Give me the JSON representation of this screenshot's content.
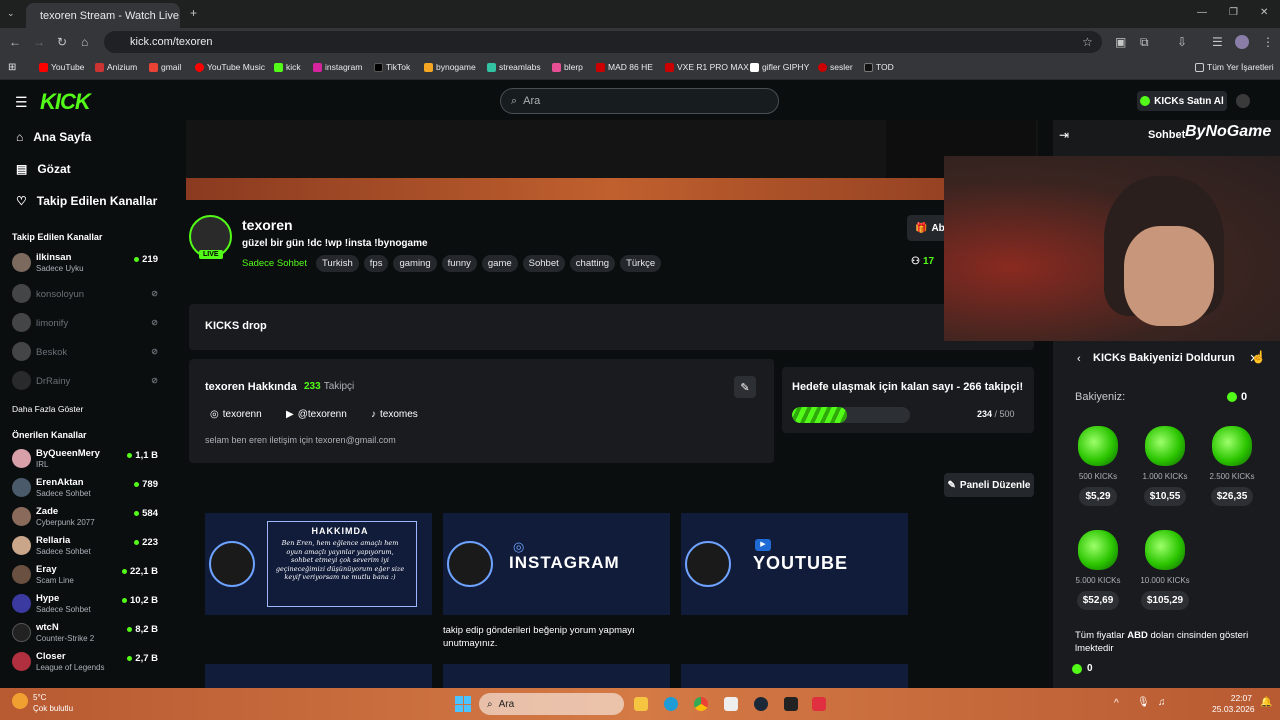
{
  "browser": {
    "tab_title": "texoren Stream - Watch Live o",
    "url": "kick.com/texoren",
    "bookmarks": [
      "YouTube",
      "Anizium",
      "gmail",
      "YouTube Music",
      "kick",
      "instagram",
      "TikTok",
      "bynogame",
      "streamlabs",
      "blerp",
      "MAD 86 HE",
      "VXE R1 PRO MAX",
      "gifler GIPHY",
      "sesler",
      "TOD"
    ],
    "all_bookmarks": "Tüm Yer İşaretleri"
  },
  "header": {
    "search_placeholder": "Ara",
    "buy_kicks": "KICKs Satın Al"
  },
  "nav": {
    "home": "Ana Sayfa",
    "browse": "Gözat",
    "following": "Takip Edilen Kanallar"
  },
  "followed": {
    "title": "Takip Edilen Kanallar",
    "channels": [
      {
        "name": "ilkinsan",
        "category": "Sadece Uyku",
        "viewers": "219",
        "live": true
      },
      {
        "name": "konsoloyun",
        "live": false
      },
      {
        "name": "limonify",
        "live": false
      },
      {
        "name": "Beskok",
        "live": false
      },
      {
        "name": "DrRainy",
        "live": false
      }
    ],
    "show_more": "Daha Fazla Göster"
  },
  "recommended": {
    "title": "Önerilen Kanallar",
    "channels": [
      {
        "name": "ByQueenMery",
        "category": "IRL",
        "viewers": "1,1 B"
      },
      {
        "name": "ErenAktan",
        "category": "Sadece Sohbet",
        "viewers": "789"
      },
      {
        "name": "Zade",
        "category": "Cyberpunk 2077",
        "viewers": "584"
      },
      {
        "name": "Rellaria",
        "category": "Sadece Sohbet",
        "viewers": "223"
      },
      {
        "name": "Eray",
        "category": "Scam Line",
        "viewers": "22,1 B"
      },
      {
        "name": "Hype",
        "category": "Sadece Sohbet",
        "viewers": "10,2 B"
      },
      {
        "name": "wtcN",
        "category": "Counter-Strike 2",
        "viewers": "8,2 B"
      },
      {
        "name": "Closer",
        "category": "League of Legends",
        "viewers": "2,7 B"
      }
    ]
  },
  "stream": {
    "channel": "texoren",
    "title": "güzel bir gün !dc !wp !insta !bynogame",
    "live_badge": "LIVE",
    "category": "Sadece Sohbet",
    "tags": [
      "Turkish",
      "fps",
      "gaming",
      "funny",
      "game",
      "Sohbet",
      "chatting",
      "Türkçe"
    ],
    "viewers": "17",
    "subscribe_partial": "Ab"
  },
  "kicks_drop": "KICKS drop",
  "about": {
    "title": "texoren Hakkında",
    "followers": "233",
    "followers_label": "Takipçi",
    "socials": [
      "texorenn",
      "@texorenn",
      "texomes"
    ],
    "bio": "selam ben eren iletişim için texoren@gmail.com"
  },
  "goal": {
    "title": "Hedefe ulaşmak için kalan sayı - 266 takipçi!",
    "current": "234",
    "target": "500",
    "progress": 0.468
  },
  "edit_panel": "Paneli Düzenle",
  "panels": [
    {
      "heading": "HAKKIMDA",
      "text": "Ben Eren, hem eğlence amaçlı hem oyun amaçlı yayınlar yapıyorum, sohbet etmeyi çok severim iyi geçineceğimizi düşünüyorum eğer size keyif veriyorsam ne mutlu bana :)"
    },
    {
      "heading": "INSTAGRAM",
      "caption": "takip edip gönderileri beğenip yorum yapmayı unutmayınız."
    },
    {
      "heading": "YOUTUBE"
    }
  ],
  "chat": {
    "title": "Sohbet",
    "brand": "ByNoGame"
  },
  "kicks_panel": {
    "title": "KICKs Bakiyenizi Doldurun",
    "balance_label": "Bakiyeniz:",
    "balance": "0",
    "items": [
      {
        "amount": "500 KICKs",
        "price": "$5,29"
      },
      {
        "amount": "1.000 KICKs",
        "price": "$10,55"
      },
      {
        "amount": "2.500 KICKs",
        "price": "$26,35"
      },
      {
        "amount": "5.000 KICKs",
        "price": "$52,69"
      },
      {
        "amount": "10.000 KICKs",
        "price": "$105,29"
      }
    ],
    "note_pre": "Tüm fiyatlar ",
    "note_bold": "ABD",
    "note_post": " doları cinsinden gösteri lmektedir",
    "footer_balance": "0"
  },
  "taskbar": {
    "weather_temp": "5°C",
    "weather_desc": "Çok bulutlu",
    "search": "Ara",
    "time": "22:07",
    "date": "25.03.2026"
  }
}
